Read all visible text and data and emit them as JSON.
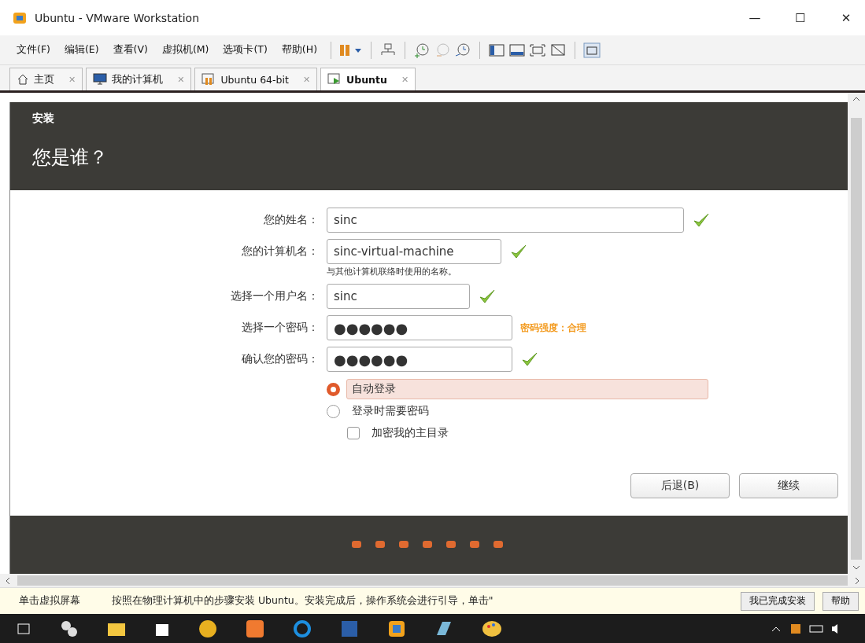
{
  "window": {
    "title": "Ubuntu - VMware Workstation",
    "controls": [
      "—",
      "☐",
      "✕"
    ]
  },
  "menu": [
    "文件(F)",
    "编辑(E)",
    "查看(V)",
    "虚拟机(M)",
    "选项卡(T)",
    "帮助(H)"
  ],
  "tabs": [
    {
      "label": "主页",
      "close": "✕",
      "selected": false
    },
    {
      "label": "我的计算机",
      "close": "✕",
      "selected": false
    },
    {
      "label": "Ubuntu 64-bit",
      "close": "✕",
      "selected": false
    },
    {
      "label": "Ubuntu",
      "close": "✕",
      "selected": true
    }
  ],
  "installer": {
    "section": "安装",
    "heading": "您是谁？",
    "fields": [
      {
        "label": "您的姓名：",
        "value": "sinc",
        "kind": "text",
        "valid": true
      },
      {
        "label": "您的计算机名：",
        "value": "sinc-virtual-machine",
        "kind": "text",
        "valid": true,
        "hint": "与其他计算机联络时使用的名称。"
      },
      {
        "label": "选择一个用户名：",
        "value": "sinc",
        "kind": "text",
        "valid": true
      },
      {
        "label": "选择一个密码：",
        "value": "●●●●●●",
        "kind": "password",
        "valid": false,
        "strength": "密码强度：合理"
      },
      {
        "label": "确认您的密码：",
        "value": "●●●●●●",
        "kind": "password",
        "valid": true
      }
    ],
    "login_options": [
      {
        "label": "自动登录",
        "selected": true
      },
      {
        "label": "登录时需要密码",
        "selected": false
      }
    ],
    "encrypt": {
      "label": "加密我的主目录",
      "checked": false
    },
    "buttons": [
      "后退(B)",
      "继续"
    ]
  },
  "hint_bar": {
    "title": "单击虚拟屏幕",
    "message": "按照在物理计算机中的步骤安装 Ubuntu。安装完成后，操作系统会进行引导，单击\"",
    "buttons": [
      "我已完成安装",
      "帮助"
    ]
  }
}
